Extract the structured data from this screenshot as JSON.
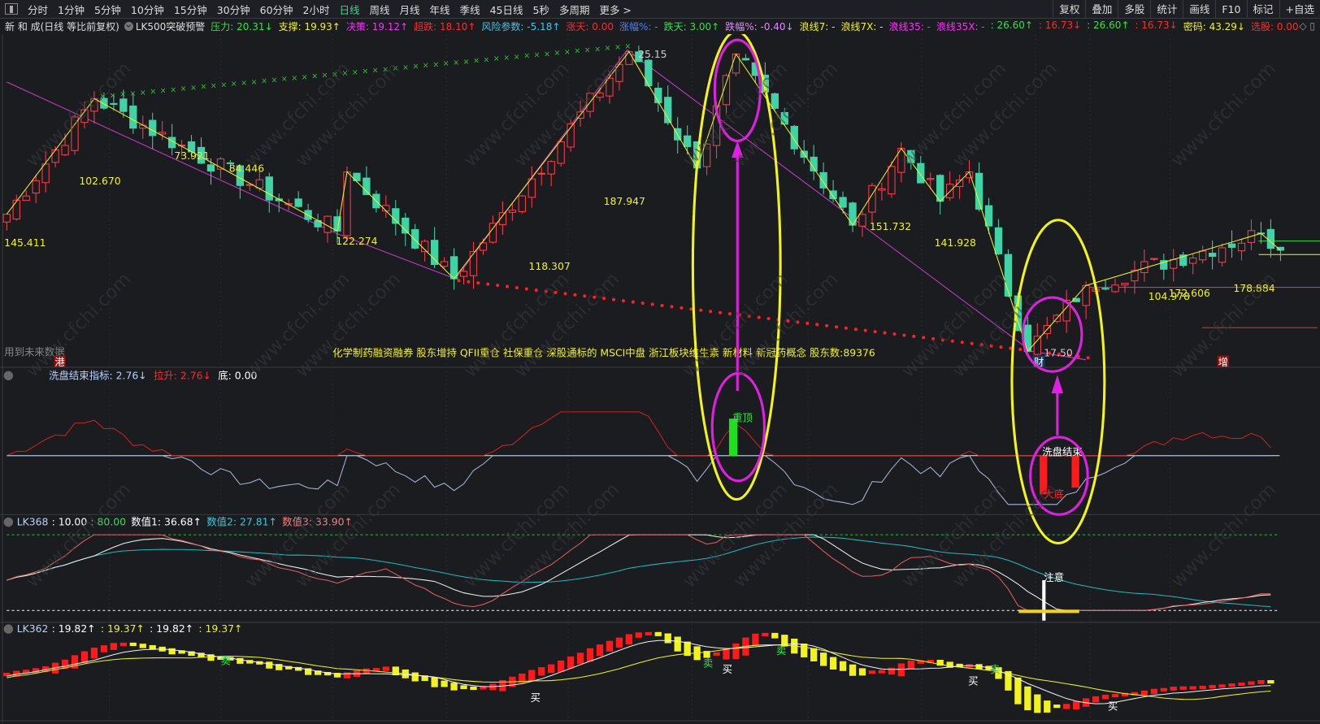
{
  "toolbar": {
    "tabs": [
      "分时",
      "1分钟",
      "5分钟",
      "10分钟",
      "15分钟",
      "30分钟",
      "60分钟",
      "2小时",
      "日线",
      "周线",
      "月线",
      "年线",
      "季线",
      "45日线",
      "5秒",
      "多周期",
      "更多 >"
    ],
    "active_tab": "日线",
    "right_buttons": [
      "复权",
      "叠加",
      "多股",
      "统计",
      "画线",
      "F10",
      "标记",
      "+自选"
    ]
  },
  "header": {
    "stock_title": "新 和 成(日线 等比前复权)",
    "indicator_name": "LK500突破预警",
    "values": [
      {
        "label": "压力",
        "value": ": 20.31↓",
        "color": "#2ee04a"
      },
      {
        "label": "支撑",
        "value": ": 19.93↑",
        "color": "#f2f21e"
      },
      {
        "label": "决策",
        "value": ": 19.12↑",
        "color": "#ff2cff"
      },
      {
        "label": "超跌",
        "value": ": 18.10↑",
        "color": "#ff2a2a"
      },
      {
        "label": "风险参数",
        "value": ": -5.18↑",
        "color": "#38c8ef"
      },
      {
        "label": "涨天",
        "value": ": 0.00",
        "color": "#ff2a2a"
      },
      {
        "label": "涨幅%",
        "value": ": -",
        "color": "#4a80ff"
      },
      {
        "label": "跌天",
        "value": ": 3.00↑",
        "color": "#2ee04a"
      },
      {
        "label": "跌幅%",
        "value": ": -0.40↓",
        "color": "#e088ff"
      },
      {
        "label": "浪线7",
        "value": ": -",
        "color": "#f2f21e"
      },
      {
        "label": "浪线7X",
        "value": ": -",
        "color": "#f2f21e"
      },
      {
        "label": "浪线35",
        "value": ": -",
        "color": "#ff2cff"
      },
      {
        "label": "浪线35X",
        "value": ": -",
        "color": "#ff2cff"
      },
      {
        "label": "",
        "value": ": 26.60↑",
        "color": "#2ee04a"
      },
      {
        "label": "",
        "value": ": 16.73↓",
        "color": "#ff2a2a"
      },
      {
        "label": "",
        "value": ": 26.60↑",
        "color": "#2ee04a"
      },
      {
        "label": "",
        "value": ": 16.73↓",
        "color": "#ff2a2a"
      },
      {
        "label": "密码",
        "value": ": 43.29↓",
        "color": "#f2f21e"
      },
      {
        "label": "选股",
        "value": ": 0.00",
        "color": "#ff2a2a"
      }
    ]
  },
  "main_chart": {
    "labels": [
      "145.411",
      "102.670",
      "73.921",
      "84.446",
      "122.274",
      "118.307",
      "187.947",
      "25.15",
      "151.732",
      "141.928",
      "17.50",
      "104.978",
      "172.606",
      "178.884"
    ],
    "future_data_note": "用到未来数据",
    "news_line": "化学制药融资融券 股东增持 QFII重仓 社保重仓 深股通标的 MSCI中盘 浙江板块维生素 新材料 新冠药概念 股东数:89376",
    "badges": [
      "港",
      "财",
      "增"
    ]
  },
  "panel2": {
    "name": "洗盘结束指标",
    "value": ": 2.76↓",
    "lift_label": "拉升",
    "lift_value": ": 2.76↓",
    "bottom_label": "底",
    "bottom_value": ": 0.00",
    "marks": [
      "重顶",
      "洗盘结束",
      "大底"
    ]
  },
  "panel3": {
    "name": "LK368",
    "v1": ": 10.00",
    "v2": ": 80.00",
    "s1": "数值1: 36.68↑",
    "s2": "数值2: 27.81↑",
    "s3": "数值3: 33.90↑",
    "mark": "注意"
  },
  "panel4": {
    "name": "LK362",
    "v1": ": 19.82↑",
    "v2": ": 19.37↑",
    "v3": ": 19.82↑",
    "v4": ": 19.37↑",
    "buy": "买",
    "sell": "卖"
  },
  "chart_data": {
    "type": "candlestick",
    "x_unit": "trading day index",
    "zigzag_pivots": [
      {
        "i": 0,
        "price": 21.0
      },
      {
        "i": 9,
        "price": 23.95
      },
      {
        "i": 34,
        "price": 20.57
      },
      {
        "i": 35,
        "price": 22.08
      },
      {
        "i": 46,
        "price": 19.35
      },
      {
        "i": 64,
        "price": 25.15
      },
      {
        "i": 71,
        "price": 22.18
      },
      {
        "i": 75,
        "price": 25.09
      },
      {
        "i": 87,
        "price": 20.72
      },
      {
        "i": 92,
        "price": 22.68
      },
      {
        "i": 96,
        "price": 21.33
      },
      {
        "i": 99,
        "price": 22.08
      },
      {
        "i": 105,
        "price": 17.5
      },
      {
        "i": 111,
        "price": 19.18
      },
      {
        "i": 129,
        "price": 20.51
      },
      {
        "i": 131,
        "price": 20.08
      }
    ],
    "high_label": 25.15,
    "low_label": 17.5
  },
  "colors": {
    "up": "#ff3c4c",
    "down": "#3fd3a6",
    "yellow": "#f2f21e",
    "magenta": "#d23cd2",
    "bg": "#1b1c20"
  }
}
